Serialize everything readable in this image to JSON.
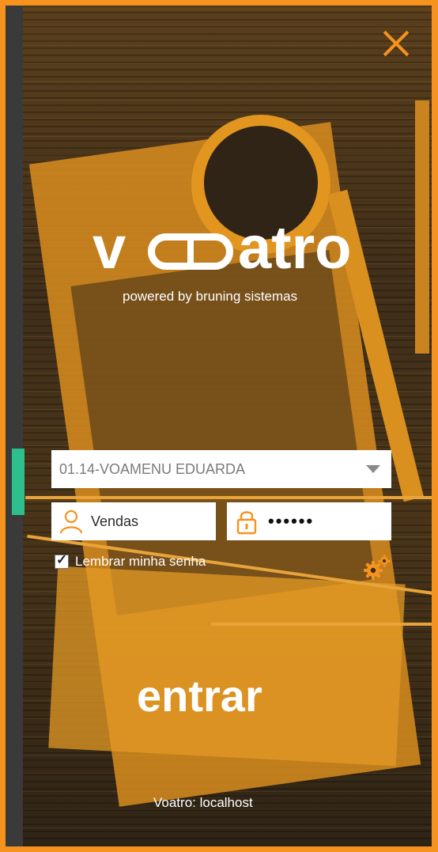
{
  "brand": {
    "logo_v": "v",
    "logo_rest": "atro",
    "tagline": "powered by bruning sistemas"
  },
  "login": {
    "company": "01.14-VOAMENU EDUARDA",
    "username": "Vendas",
    "password_mask": "••••••",
    "remember_label": "Lembrar minha senha",
    "remember_checked": true,
    "enter_label": "entrar"
  },
  "footer": {
    "server": "Voatro: localhost"
  },
  "colors": {
    "accent": "#f6931e",
    "text": "#ffffff",
    "tab": "#2dbf8c"
  },
  "icons": [
    "close-icon",
    "chevron-down-icon",
    "user-icon",
    "lock-icon",
    "check-icon",
    "gear-icon"
  ]
}
